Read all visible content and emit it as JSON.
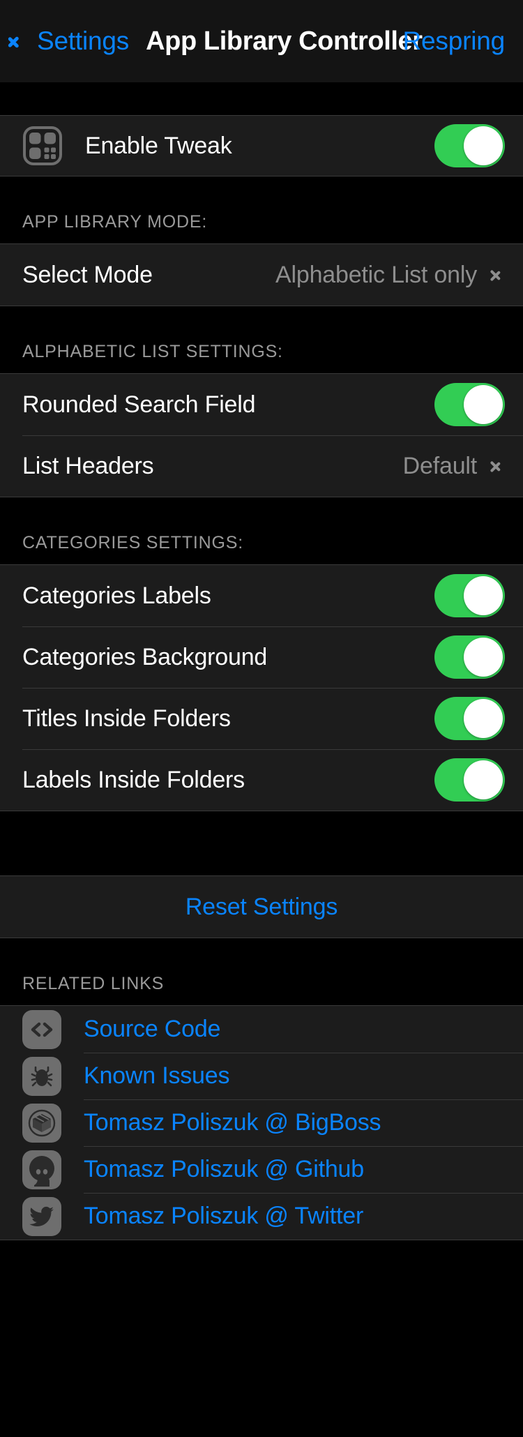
{
  "nav": {
    "back_label": "Settings",
    "back_icon": "chevron-left-icon",
    "title": "App Library Controller",
    "action_label": "Respring"
  },
  "colors": {
    "accent_blue": "#0a84ff",
    "switch_on_green": "#32cd54",
    "row_background": "#1c1c1c",
    "page_background": "#000000",
    "separator": "#3a3a3a",
    "secondary_text": "#8e8e8e",
    "header_text": "#9a9a9a"
  },
  "sections": [
    {
      "id": "enable",
      "header": "",
      "rows": [
        {
          "name": "enable-tweak",
          "icon": "app-library-grid-icon",
          "label": "Enable Tweak",
          "control": "switch",
          "value": "on"
        }
      ]
    },
    {
      "id": "app-library-mode",
      "header": "APP LIBRARY MODE:",
      "rows": [
        {
          "name": "select-mode",
          "label": "Select Mode",
          "control": "disclosure",
          "value": "Alphabetic List only"
        }
      ]
    },
    {
      "id": "alphabetic-list-settings",
      "header": "ALPHABETIC LIST SETTINGS:",
      "rows": [
        {
          "name": "rounded-search-field",
          "label": "Rounded Search Field",
          "control": "switch",
          "value": "on"
        },
        {
          "name": "list-headers",
          "label": "List Headers",
          "control": "disclosure",
          "value": "Default"
        }
      ]
    },
    {
      "id": "categories-settings",
      "header": "CATEGORIES SETTINGS:",
      "rows": [
        {
          "name": "categories-labels",
          "label": "Categories Labels",
          "control": "switch",
          "value": "on"
        },
        {
          "name": "categories-background",
          "label": "Categories Background",
          "control": "switch",
          "value": "on"
        },
        {
          "name": "titles-inside-folders",
          "label": "Titles Inside Folders",
          "control": "switch",
          "value": "on"
        },
        {
          "name": "labels-inside-folders",
          "label": "Labels Inside Folders",
          "control": "switch",
          "value": "on"
        }
      ]
    }
  ],
  "reset": {
    "label": "Reset Settings"
  },
  "related_links": {
    "header": "RELATED LINKS",
    "items": [
      {
        "name": "source-code",
        "icon": "code-brackets-icon",
        "label": "Source Code"
      },
      {
        "name": "known-issues",
        "icon": "bug-icon",
        "label": "Known Issues"
      },
      {
        "name": "author-bigboss",
        "icon": "cydia-package-icon",
        "label": "Tomasz Poliszuk @ BigBoss"
      },
      {
        "name": "author-github",
        "icon": "github-icon",
        "label": "Tomasz Poliszuk @ Github"
      },
      {
        "name": "author-twitter",
        "icon": "twitter-icon",
        "label": "Tomasz Poliszuk @ Twitter"
      }
    ]
  }
}
